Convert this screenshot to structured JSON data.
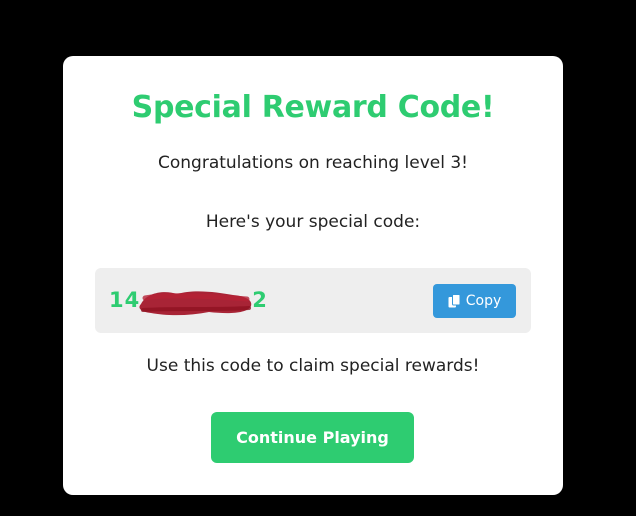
{
  "modal": {
    "title": "Special Reward Code!",
    "congrats_text": "Congratulations on reaching level 3!",
    "intro_text": "Here's your special code:",
    "code": {
      "prefix": "14",
      "suffix": "2",
      "redacted": true
    },
    "copy_button": {
      "label": "Copy",
      "icon": "copy-icon"
    },
    "instruction_text": "Use this code to claim special rewards!",
    "continue_button_label": "Continue Playing"
  },
  "colors": {
    "backdrop": "#000000",
    "modal_bg": "#ffffff",
    "accent_green": "#2ecc71",
    "copy_blue": "#3498db",
    "code_box_bg": "#eeeeee",
    "redaction_red": "#a3182b"
  }
}
